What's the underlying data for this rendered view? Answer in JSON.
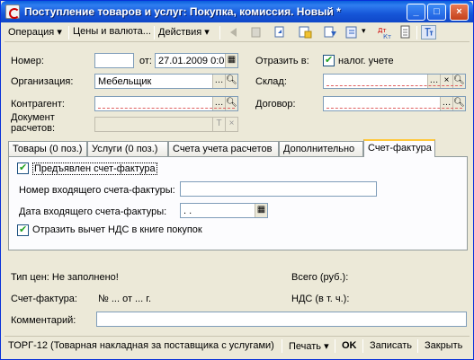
{
  "window": {
    "title": "Поступление товаров и услуг: Покупка, комиссия. Новый *",
    "buttons": {
      "minimize": "_",
      "maximize": "□",
      "close": "×"
    }
  },
  "toolbar": {
    "operation": "Операция",
    "prices_currency": "Цены и валюта...",
    "actions": "Действия",
    "dropdown_glyph": "▾",
    "icons": [
      "back-icon",
      "copy-icon",
      "refresh-icon",
      "post-doc-icon",
      "structure-icon",
      "journal-icon",
      "dt-kt-icon",
      "document-icon",
      "settings-icon"
    ]
  },
  "header": {
    "number_label": "Номер:",
    "number_value": "",
    "date_from_label": "от:",
    "date_value": "27.01.2009  0:0",
    "reflect_label": "Отразить в:",
    "tax_accounting_label": "налог. учете",
    "tax_accounting_checked": true,
    "organization_label": "Организация:",
    "organization_value": "Мебельщик",
    "warehouse_label": "Склад:",
    "warehouse_value": "",
    "counterparty_label": "Контрагент:",
    "counterparty_value": "",
    "contract_label": "Договор:",
    "contract_value": "",
    "settlement_doc_label_1": "Документ",
    "settlement_doc_label_2": "расчетов:",
    "settlement_doc_value": ""
  },
  "tabs": [
    {
      "label": "Товары (0 поз.)",
      "active": false
    },
    {
      "label": "Услуги (0 поз.)",
      "active": false
    },
    {
      "label": "Счета учета расчетов",
      "active": false
    },
    {
      "label": "Дополнительно",
      "active": false
    },
    {
      "label": "Счет-фактура",
      "active": true
    }
  ],
  "invoice_tab": {
    "presented_label": "Предъявлен счет-фактура",
    "presented_checked": true,
    "incoming_number_label": "Номер входящего счета-фактуры:",
    "incoming_number_value": "",
    "incoming_date_label": "Дата входящего счета-фактуры:",
    "incoming_date_value": " .  .",
    "vat_deduction_label": "Отразить вычет НДС в книге покупок",
    "vat_deduction_checked": true
  },
  "footer": {
    "price_type": "Тип цен: Не заполнено!",
    "total_label": "Всего (руб.):",
    "invoice_label": "Счет-фактура:",
    "invoice_ref": "№ ...  от  ... г.",
    "vat_label": "НДС (в т. ч.):",
    "comment_label": "Комментарий:",
    "comment_value": ""
  },
  "bottom_bar": {
    "torg12": "ТОРГ-12 (Товарная накладная за поставщика с услугами)",
    "print": "Печать",
    "ok": "OK",
    "save": "Записать",
    "close": "Закрыть"
  },
  "colors": {
    "title_bar": "#1656d8",
    "window_bg": "#ece9d8",
    "field_border": "#7f9db9",
    "required_underline": "#e06060",
    "active_tab_accent": "#ffc83c"
  }
}
